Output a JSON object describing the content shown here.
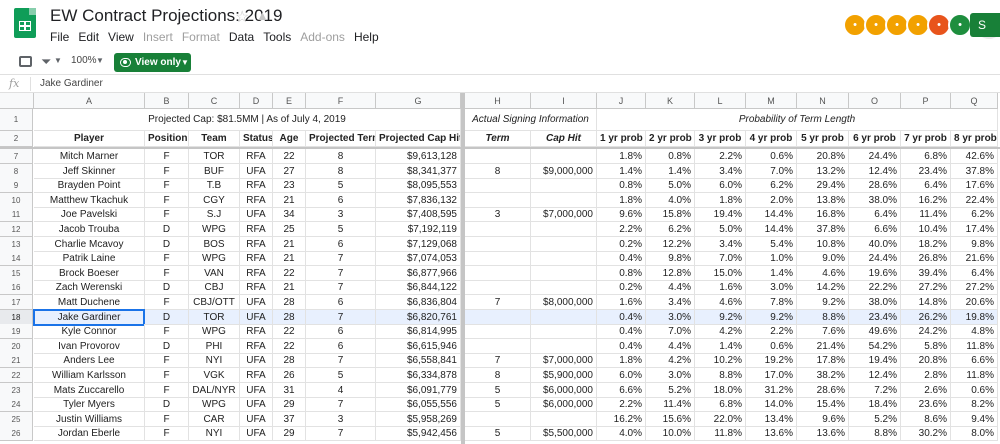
{
  "title": "EW Contract Projections: 2019",
  "menu": [
    "File",
    "Edit",
    "View",
    "Insert",
    "Format",
    "Data",
    "Tools",
    "Add-ons",
    "Help"
  ],
  "menu_disabled": [
    false,
    false,
    false,
    true,
    true,
    false,
    false,
    true,
    false
  ],
  "collaborators": {
    "count_label": "+31",
    "avatar_colors": [
      "#f2a100",
      "#f2a100",
      "#f2a100",
      "#f2a100",
      "#e8541c",
      "#1e8e3e"
    ],
    "share_label": "S"
  },
  "toolbar": {
    "zoom": "100%",
    "view_only": "View only"
  },
  "formula_bar": {
    "fx": "fx",
    "value": "Jake Gardiner"
  },
  "columns": [
    "A",
    "B",
    "C",
    "D",
    "E",
    "F",
    "G",
    "H",
    "I",
    "J",
    "K",
    "L",
    "M",
    "N",
    "O",
    "P",
    "Q"
  ],
  "banner": {
    "left": "Projected Cap: $81.5MM | As of July 4, 2019",
    "middle": "Actual Signing Information",
    "right": "Probability of Term Length"
  },
  "headers": [
    "Player",
    "Position",
    "Team",
    "Status",
    "Age",
    "Projected Term",
    "Projected Cap Hit",
    "Term",
    "Cap Hit",
    "1 yr prob",
    "2 yr prob",
    "3 yr prob",
    "4 yr prob",
    "5 yr prob",
    "6 yr prob",
    "7 yr prob",
    "8 yr prob"
  ],
  "selected_row": "18",
  "rows": [
    {
      "row": "7",
      "cells": [
        "Mitch Marner",
        "F",
        "TOR",
        "RFA",
        "22",
        "8",
        "$9,613,128",
        "",
        "",
        "1.8%",
        "0.8%",
        "2.2%",
        "0.6%",
        "20.8%",
        "24.4%",
        "6.8%",
        "42.6%"
      ]
    },
    {
      "row": "8",
      "cells": [
        "Jeff Skinner",
        "F",
        "BUF",
        "UFA",
        "27",
        "8",
        "$8,341,377",
        "8",
        "$9,000,000",
        "1.4%",
        "1.4%",
        "3.4%",
        "7.0%",
        "13.2%",
        "12.4%",
        "23.4%",
        "37.8%"
      ]
    },
    {
      "row": "9",
      "cells": [
        "Brayden Point",
        "F",
        "T.B",
        "RFA",
        "23",
        "5",
        "$8,095,553",
        "",
        "",
        "0.8%",
        "5.0%",
        "6.0%",
        "6.2%",
        "29.4%",
        "28.6%",
        "6.4%",
        "17.6%"
      ]
    },
    {
      "row": "10",
      "cells": [
        "Matthew Tkachuk",
        "F",
        "CGY",
        "RFA",
        "21",
        "6",
        "$7,836,132",
        "",
        "",
        "1.8%",
        "4.0%",
        "1.8%",
        "2.0%",
        "13.8%",
        "38.0%",
        "16.2%",
        "22.4%"
      ]
    },
    {
      "row": "11",
      "cells": [
        "Joe Pavelski",
        "F",
        "S.J",
        "UFA",
        "34",
        "3",
        "$7,408,595",
        "3",
        "$7,000,000",
        "9.6%",
        "15.8%",
        "19.4%",
        "14.4%",
        "16.8%",
        "6.4%",
        "11.4%",
        "6.2%"
      ]
    },
    {
      "row": "12",
      "cells": [
        "Jacob Trouba",
        "D",
        "WPG",
        "RFA",
        "25",
        "5",
        "$7,192,119",
        "",
        "",
        "2.2%",
        "6.2%",
        "5.0%",
        "14.4%",
        "37.8%",
        "6.6%",
        "10.4%",
        "17.4%"
      ]
    },
    {
      "row": "13",
      "cells": [
        "Charlie Mcavoy",
        "D",
        "BOS",
        "RFA",
        "21",
        "6",
        "$7,129,068",
        "",
        "",
        "0.2%",
        "12.2%",
        "3.4%",
        "5.4%",
        "10.8%",
        "40.0%",
        "18.2%",
        "9.8%"
      ]
    },
    {
      "row": "14",
      "cells": [
        "Patrik Laine",
        "F",
        "WPG",
        "RFA",
        "21",
        "7",
        "$7,074,053",
        "",
        "",
        "0.4%",
        "9.8%",
        "7.0%",
        "1.0%",
        "9.0%",
        "24.4%",
        "26.8%",
        "21.6%"
      ]
    },
    {
      "row": "15",
      "cells": [
        "Brock Boeser",
        "F",
        "VAN",
        "RFA",
        "22",
        "7",
        "$6,877,966",
        "",
        "",
        "0.8%",
        "12.8%",
        "15.0%",
        "1.4%",
        "4.6%",
        "19.6%",
        "39.4%",
        "6.4%"
      ]
    },
    {
      "row": "16",
      "cells": [
        "Zach Werenski",
        "D",
        "CBJ",
        "RFA",
        "21",
        "7",
        "$6,844,122",
        "",
        "",
        "0.2%",
        "4.4%",
        "1.6%",
        "3.0%",
        "14.2%",
        "22.2%",
        "27.2%",
        "27.2%"
      ]
    },
    {
      "row": "17",
      "cells": [
        "Matt Duchene",
        "F",
        "CBJ/OTT",
        "UFA",
        "28",
        "6",
        "$6,836,804",
        "7",
        "$8,000,000",
        "1.6%",
        "3.4%",
        "4.6%",
        "7.8%",
        "9.2%",
        "38.0%",
        "14.8%",
        "20.6%"
      ]
    },
    {
      "row": "18",
      "cells": [
        "Jake Gardiner",
        "D",
        "TOR",
        "UFA",
        "28",
        "7",
        "$6,820,761",
        "",
        "",
        "0.4%",
        "3.0%",
        "9.2%",
        "9.2%",
        "8.8%",
        "23.4%",
        "26.2%",
        "19.8%"
      ]
    },
    {
      "row": "19",
      "cells": [
        "Kyle Connor",
        "F",
        "WPG",
        "RFA",
        "22",
        "6",
        "$6,814,995",
        "",
        "",
        "0.4%",
        "7.0%",
        "4.2%",
        "2.2%",
        "7.6%",
        "49.6%",
        "24.2%",
        "4.8%"
      ]
    },
    {
      "row": "20",
      "cells": [
        "Ivan Provorov",
        "D",
        "PHI",
        "RFA",
        "22",
        "6",
        "$6,615,946",
        "",
        "",
        "0.4%",
        "4.4%",
        "1.4%",
        "0.6%",
        "21.4%",
        "54.2%",
        "5.8%",
        "11.8%"
      ]
    },
    {
      "row": "21",
      "cells": [
        "Anders Lee",
        "F",
        "NYI",
        "UFA",
        "28",
        "7",
        "$6,558,841",
        "7",
        "$7,000,000",
        "1.8%",
        "4.2%",
        "10.2%",
        "19.2%",
        "17.8%",
        "19.4%",
        "20.8%",
        "6.6%"
      ]
    },
    {
      "row": "22",
      "cells": [
        "William Karlsson",
        "F",
        "VGK",
        "RFA",
        "26",
        "5",
        "$6,334,878",
        "8",
        "$5,900,000",
        "6.0%",
        "3.0%",
        "8.8%",
        "17.0%",
        "38.2%",
        "12.4%",
        "2.8%",
        "11.8%"
      ]
    },
    {
      "row": "23",
      "cells": [
        "Mats Zuccarello",
        "F",
        "DAL/NYR",
        "UFA",
        "31",
        "4",
        "$6,091,779",
        "5",
        "$6,000,000",
        "6.6%",
        "5.2%",
        "18.0%",
        "31.2%",
        "28.6%",
        "7.2%",
        "2.6%",
        "0.6%"
      ]
    },
    {
      "row": "24",
      "cells": [
        "Tyler Myers",
        "D",
        "WPG",
        "UFA",
        "29",
        "7",
        "$6,055,556",
        "5",
        "$6,000,000",
        "2.2%",
        "11.4%",
        "6.8%",
        "14.0%",
        "15.4%",
        "18.4%",
        "23.6%",
        "8.2%"
      ]
    },
    {
      "row": "25",
      "cells": [
        "Justin Williams",
        "F",
        "CAR",
        "UFA",
        "37",
        "3",
        "$5,958,269",
        "",
        "",
        "16.2%",
        "15.6%",
        "22.0%",
        "13.4%",
        "9.6%",
        "5.2%",
        "8.6%",
        "9.4%"
      ]
    },
    {
      "row": "26",
      "cells": [
        "Jordan Eberle",
        "F",
        "NYI",
        "UFA",
        "29",
        "7",
        "$5,942,456",
        "5",
        "$5,500,000",
        "4.0%",
        "10.0%",
        "11.8%",
        "13.6%",
        "13.6%",
        "8.8%",
        "30.2%",
        "8.0%"
      ]
    }
  ]
}
